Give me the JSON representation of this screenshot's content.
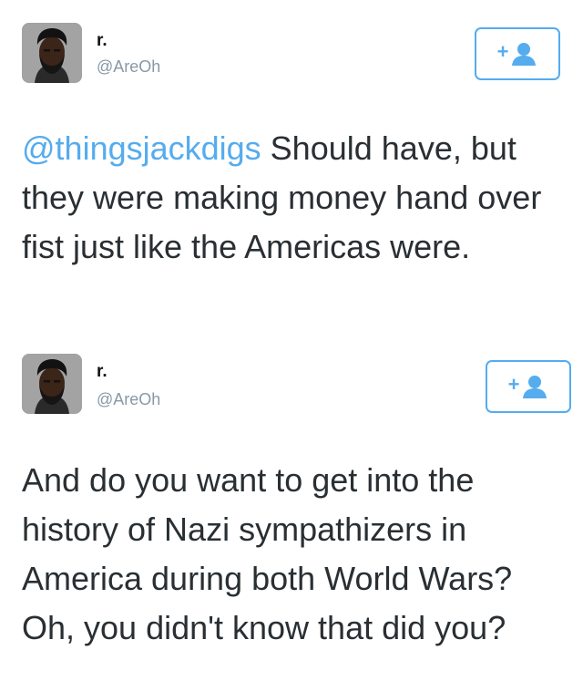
{
  "tweets": [
    {
      "user": {
        "name": "r.",
        "handle": "@AreOh"
      },
      "mention": "@thingsjackdigs",
      "text": " Should have, but they were making money hand over fist just like the Americas were.",
      "follow_icon": "add-user-icon"
    },
    {
      "user": {
        "name": "r.",
        "handle": "@AreOh"
      },
      "text": "And do you want to get into the history of Nazi sympathizers in America during both World Wars? Oh, you didn't know that did you?",
      "follow_icon": "add-user-icon"
    }
  ],
  "colors": {
    "accent": "#55acee",
    "handle": "#8899a6",
    "text": "#292f33"
  }
}
